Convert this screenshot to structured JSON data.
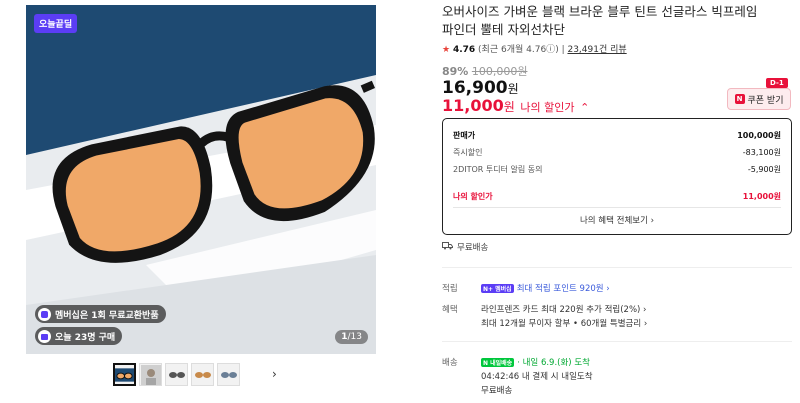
{
  "gallery": {
    "badge": "오늘끝딜",
    "pill_membership": "멤버십은 1회 무료교환반품",
    "pill_today": "오늘 23명 구매",
    "counter_current": "1",
    "counter_total": "/13",
    "prev_arrow": "‹",
    "next_arrow": "›",
    "colors": {
      "backdrop": "#1e4a72",
      "lens": "#f0a868",
      "frame": "#141414"
    }
  },
  "product": {
    "title": "오버사이즈 가벼운 블랙 브라운 블루 틴트 선글라스 빅프레임 파인더 뿔테 자외선차단",
    "rating": "4.76",
    "rating_detail": "(최근 6개월 4.76",
    "rating_detail_tail": ")",
    "reviews": "23,491건 리뷰",
    "discount_pct": "89%",
    "original_price": "100,000원",
    "price": "16,900",
    "price_unit": "원",
    "my_price": "11,000",
    "my_price_unit": "원",
    "my_price_label": "나의 할인가",
    "coupon_label": "쿠폰 받기",
    "coupon_badge": "D-1",
    "coupon_n": "N"
  },
  "price_box": {
    "rows": [
      {
        "label": "판매가",
        "value": "100,000원"
      },
      {
        "label": "즉시할인",
        "value": "-83,100원"
      },
      {
        "label": "2DITOR 투디터 알림 동의",
        "value": "-5,900원"
      }
    ],
    "mine_label": "나의 할인가",
    "mine_value": "11,000원",
    "benefits_link": "나의 혜택 전체보기 ›"
  },
  "shipping": {
    "free_label": "무료배송"
  },
  "details": {
    "points_label": "적립",
    "points_badge": "N+ 멤버십",
    "points_text": "최대 적립 포인트 920원 ›",
    "benefit_label": "혜택",
    "benefit_line1": "라인프렌즈 카드 최대 220원 추가 적립(2%) ›",
    "benefit_line2": "최대 12개월 무이자 할부 • 60개월 특별금리 ›",
    "delivery_label": "배송",
    "delivery_badge": "N 내일배송",
    "delivery_eta": "· 내일 6.9.(화) 도착",
    "delivery_line2": "04:42:46  내 결제 시 내일도착",
    "delivery_line3": "무료배송"
  }
}
